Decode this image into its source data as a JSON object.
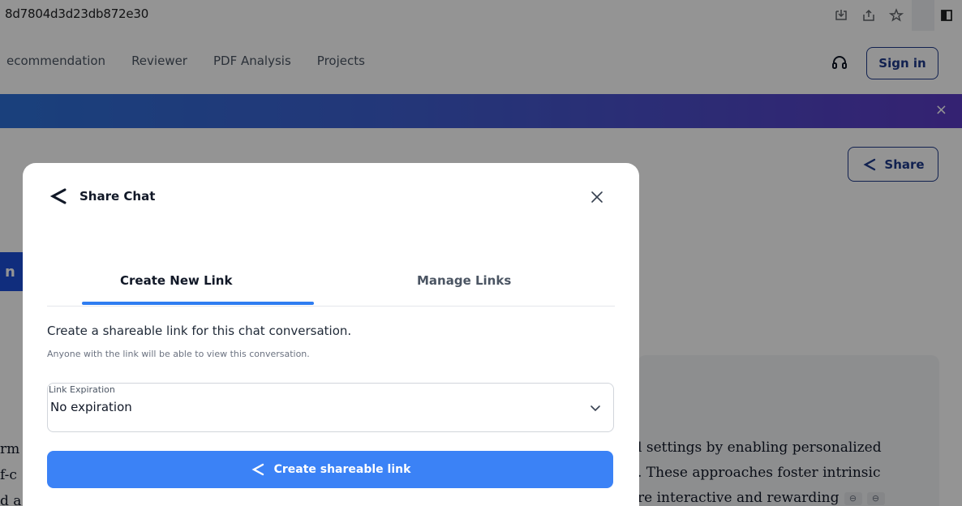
{
  "browser": {
    "url": "8d7804d3d23db872e30",
    "icons": [
      "download-icon",
      "share-page-icon",
      "star-icon",
      "sidebar-icon"
    ]
  },
  "nav": {
    "links": [
      "ecommendation",
      "Reviewer",
      "PDF Analysis",
      "Projects"
    ],
    "sign_in": "Sign in",
    "banner_close": "×"
  },
  "page": {
    "share_button": "Share",
    "left_chip": "n",
    "bg_lines_right": [
      "l settings by enabling personalized",
      ". These approaches foster intrinsic",
      "re interactive and rewarding"
    ],
    "bg_lines_left": [
      "rm",
      "f-c",
      "d a"
    ]
  },
  "modal": {
    "title": "Share Chat",
    "tabs": [
      {
        "label": "Create New Link",
        "active": true
      },
      {
        "label": "Manage Links",
        "active": false
      }
    ],
    "description": "Create a shareable link for this chat conversation.",
    "subdescription": "Anyone with the link will be able to view this conversation.",
    "expiration": {
      "label": "Link Expiration",
      "value": "No expiration"
    },
    "create_button": "Create shareable link"
  },
  "colors": {
    "accent": "#3b82f6",
    "navy": "#1e3a8a",
    "banner_start": "#2d6fd6",
    "banner_end": "#5b3bc4"
  }
}
